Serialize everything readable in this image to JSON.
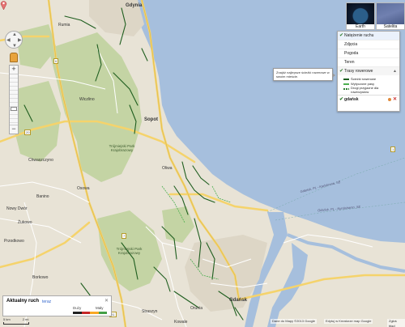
{
  "map": {
    "colors": {
      "water": "#a6bfdd",
      "land": "#e8e3d6",
      "forest": "#c4d4a4",
      "highway": "#f5d36b",
      "road": "#ffffff",
      "bike": "#1f5e1f"
    },
    "labels": {
      "gdynia": "Gdynia",
      "sopot": "Sopot",
      "gdansk": "Gdańsk",
      "park": "Trójmiejski Park Krajobrazowy",
      "park2": "Trójmiejski Park Krajobrazowy",
      "pl1": "Wiczlino",
      "pl2": "Chwaszczyno",
      "pl3": "Żukowo",
      "pl4": "Banino",
      "pl5": "Kowale",
      "pl6": "Pruszcz Gdański",
      "pl7": "Rumia",
      "pl8": "Oliwa",
      "pl9": "Osowa",
      "pl10": "Nowy Dwór",
      "pl11": "Przodkowo",
      "pl12": "Borkowo",
      "pl13": "Straszyn",
      "pl14": "Orunia",
      "water1": "Gdańsk, PL - Karlskrona, SE",
      "water2": "Gdańsk, PL - Nynäshamn, SE"
    },
    "shields": [
      "6",
      "7",
      "1",
      "20",
      "A1"
    ]
  },
  "nav": {
    "up": "▲",
    "down": "▼",
    "left": "◀",
    "right": "▶",
    "zoom_in": "+",
    "zoom_out": "−"
  },
  "map_type": {
    "earth": "Earth",
    "satellite": "Satelita"
  },
  "layers": {
    "items": [
      {
        "label": "Natężenie ruchu",
        "checked": true
      },
      {
        "label": "Zdjęcia",
        "checked": false
      },
      {
        "label": "Pogoda",
        "checked": false
      },
      {
        "label": "Teren",
        "checked": false
      }
    ],
    "bike": {
      "label": "Trasy rowerowe",
      "legend": [
        {
          "label": "Ścieżki rowerowe",
          "color": "#1b5e20"
        },
        {
          "label": "Wytyczone pasy",
          "color": "#4caf50"
        },
        {
          "label": "Drogi przyjazne dla rowerzystów",
          "color": "#2e7d32"
        }
      ]
    },
    "search": {
      "label": "gdańsk"
    }
  },
  "tooltip": {
    "text": "Znajdź najlepsze ścieżki rowerowe w swoim mieście."
  },
  "traffic": {
    "title": "Aktualny ruch",
    "now": "teraz",
    "close": "✕",
    "slow": "Duży",
    "fast": "Mały",
    "colors": [
      "#222",
      "#c62828",
      "#f9a825",
      "#43a047"
    ]
  },
  "scale": {
    "label": "5 km",
    "label2": "2 mi"
  },
  "footer": {
    "copyright": "Dane do Mapy ©2013 Google",
    "terms": "Edytuj w Kreatorze map Google",
    "report": "Zgłoś błąd"
  }
}
